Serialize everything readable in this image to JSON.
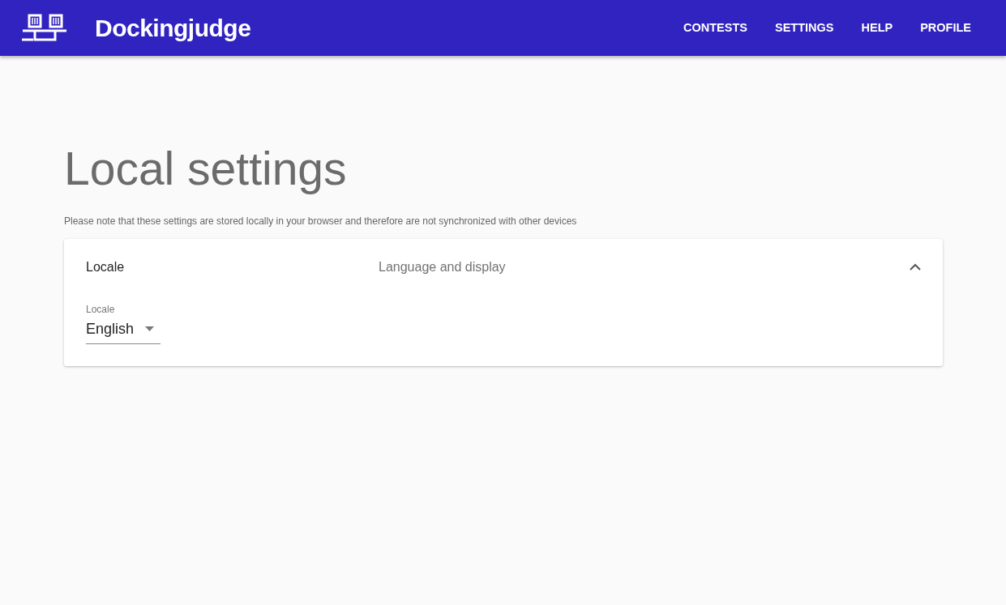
{
  "app": {
    "brand": "Dockingjudge"
  },
  "nav": [
    {
      "label": "CONTESTS"
    },
    {
      "label": "SETTINGS"
    },
    {
      "label": "HELP"
    },
    {
      "label": "PROFILE"
    }
  ],
  "page": {
    "title": "Local settings",
    "note": "Please note that these settings are stored locally in your browser and therefore are not synchronized with other devices"
  },
  "panels": [
    {
      "title": "Locale",
      "subtitle": "Language and display",
      "expanded": true,
      "field": {
        "label": "Locale",
        "value": "English"
      }
    }
  ]
}
